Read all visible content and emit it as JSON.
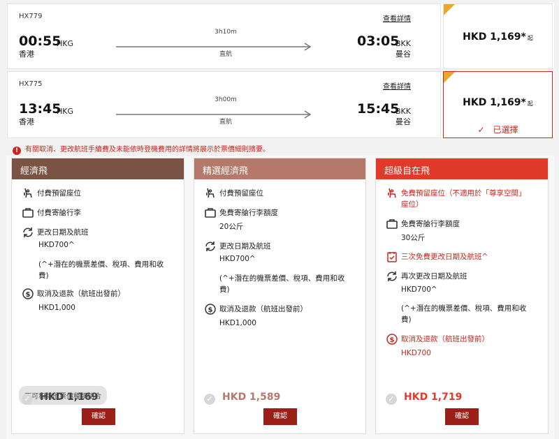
{
  "flights": [
    {
      "flight_no": "HX779",
      "details_link": "查看詳情",
      "departure": {
        "time": "00:55",
        "code": "HKG",
        "city": "香港"
      },
      "arrival": {
        "time": "03:05",
        "code": "BKK",
        "city": "曼谷"
      },
      "duration": "3h10m",
      "stops": "直航",
      "price": "HKD 1,169*",
      "price_suffix": "起",
      "selected": false
    },
    {
      "flight_no": "HX775",
      "details_link": "查看詳情",
      "departure": {
        "time": "13:45",
        "code": "HKG",
        "city": "香港"
      },
      "arrival": {
        "time": "15:45",
        "code": "BKK",
        "city": "曼谷"
      },
      "duration": "3h00m",
      "stops": "直航",
      "price": "HKD 1,169*",
      "price_suffix": "起",
      "selected": true,
      "selected_label": "已選擇"
    }
  ],
  "notice": "有關取消、更改航班手續費及未能依時登機費用的詳情將展示於票價細則摘要。",
  "colors": {
    "economy": "#7a5344",
    "premium_economy": "#b4796a",
    "super_flexi": "#e23a2a",
    "accent_red": "#c8261e",
    "badge_yellow": "#e8a92a",
    "confirm_button": "#9a1f16"
  },
  "fares": [
    {
      "name": "經濟飛",
      "seat": "付費預留座位",
      "baggage": "付費寄艙行李",
      "change": "更改日期及航班",
      "change_fee": "HKD700^",
      "change_note_1": "(^+潛在的機票差價、稅項、費用和收",
      "change_note_2": "費)",
      "refund": "取消及退款（航班出發前）",
      "refund_fee": "HKD1,000",
      "combo_badge": "不可和其他票價種類組合",
      "total": "HKD 1,169",
      "confirm": "確認"
    },
    {
      "name": "精選經濟飛",
      "seat": "付費預留座位",
      "baggage": "免費寄艙行李額度",
      "baggage_allowance": "20公斤",
      "change": "更改日期及航班",
      "change_fee": "HKD700^",
      "change_note_1": "(^+潛在的機票差價、稅項、費用和收",
      "change_note_2": "費)",
      "refund": "取消及退款（航班出發前）",
      "refund_fee": "HKD1,000",
      "total": "HKD 1,589",
      "confirm": "確認"
    },
    {
      "name": "超級自在飛",
      "seat_1": "免費預留座位（不適用於「尊享空間」",
      "seat_2": "座位）",
      "baggage": "免費寄艙行李額度",
      "baggage_allowance": "30公斤",
      "free_changes": "三次免費更改日期及航班^",
      "change": "再次更改日期及航班",
      "change_fee": "HKD700^",
      "change_note_1": "(^+潛在的機票差價、稅項、費用和收",
      "change_note_2": "費)",
      "refund": "取消及退款（航班出發前）",
      "refund_fee": "HKD700",
      "total": "HKD 1,719",
      "confirm": "確認"
    }
  ]
}
